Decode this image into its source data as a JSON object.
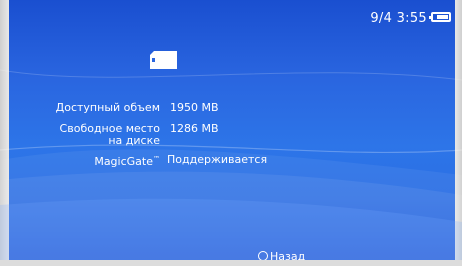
{
  "status_bar": {
    "date_time": "9/4 3:55",
    "battery_level": 0.7
  },
  "media_icon": "memory-card-icon",
  "info": [
    {
      "label": "Доступный объем",
      "value": "1950 MB"
    },
    {
      "label": "Свободное место на диске",
      "label_line1": "Свободное место",
      "label_line2": "на диске",
      "value": "1286 MB"
    },
    {
      "label": "MagicGate",
      "label_mark": "™",
      "value": "Поддерживается"
    }
  ],
  "footer": {
    "back_label": "Назад",
    "back_icon": "circle-button-icon"
  },
  "colors": {
    "background": "#2a66e0",
    "text": "#ffffff"
  }
}
